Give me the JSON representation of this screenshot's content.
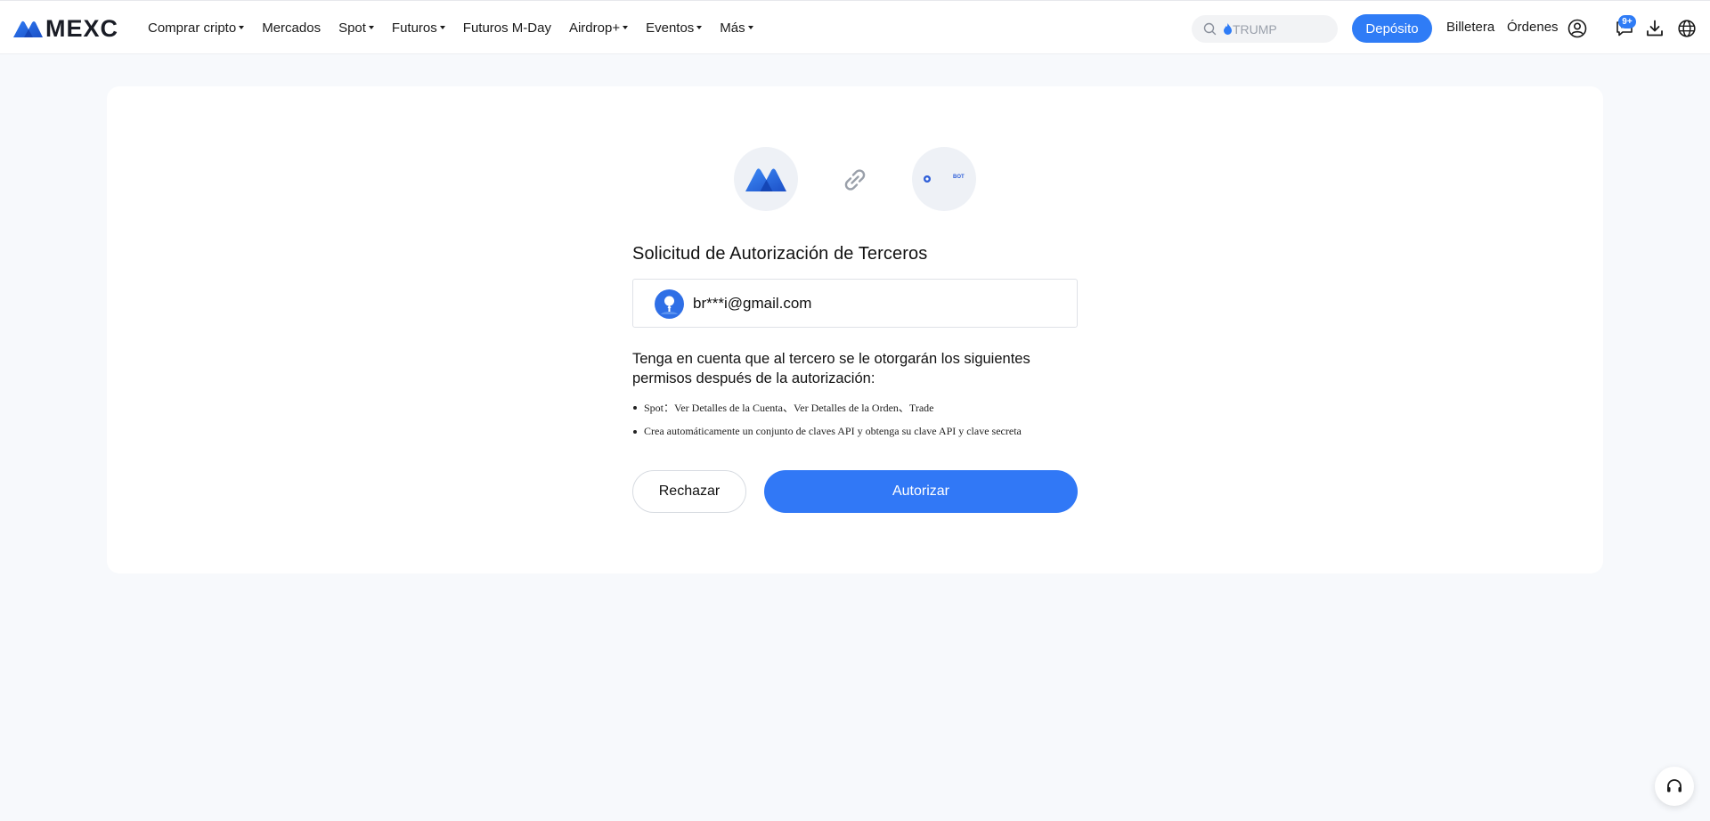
{
  "brand": {
    "name": "MEXC",
    "accent_color": "#2f7cf6"
  },
  "nav": [
    {
      "label": "Comprar cripto",
      "has_dropdown": true
    },
    {
      "label": "Mercados",
      "has_dropdown": false
    },
    {
      "label": "Spot",
      "has_dropdown": true
    },
    {
      "label": "Futuros",
      "has_dropdown": true
    },
    {
      "label": "Futuros M-Day",
      "has_dropdown": false
    },
    {
      "label": "Airdrop+",
      "has_dropdown": true
    },
    {
      "label": "Eventos",
      "has_dropdown": true
    },
    {
      "label": "Más",
      "has_dropdown": true
    }
  ],
  "header": {
    "search_placeholder": "TRUMP",
    "deposit_label": "Depósito",
    "wallet_label": "Billetera",
    "orders_label": "Órdenes",
    "notification_badge": "9+",
    "icons": [
      "search-icon",
      "flame-icon",
      "user-icon",
      "message-icon",
      "download-icon",
      "globe-icon"
    ]
  },
  "auth": {
    "title": "Solicitud de Autorización de Terceros",
    "account_email": "br***i@gmail.com",
    "notice": "Tenga en cuenta que al tercero se le otorgarán los siguientes permisos después de la autorización:",
    "permissions": [
      "Spot：Ver Detalles de la Cuenta、Ver Detalles de la Orden、Trade",
      "Crea automáticamente un conjunto de claves API y obtenga su clave API y clave secreta"
    ],
    "third_party_logo_text": "BOT",
    "reject_label": "Rechazar",
    "authorize_label": "Autorizar"
  },
  "support": {
    "icon": "headset-icon"
  }
}
